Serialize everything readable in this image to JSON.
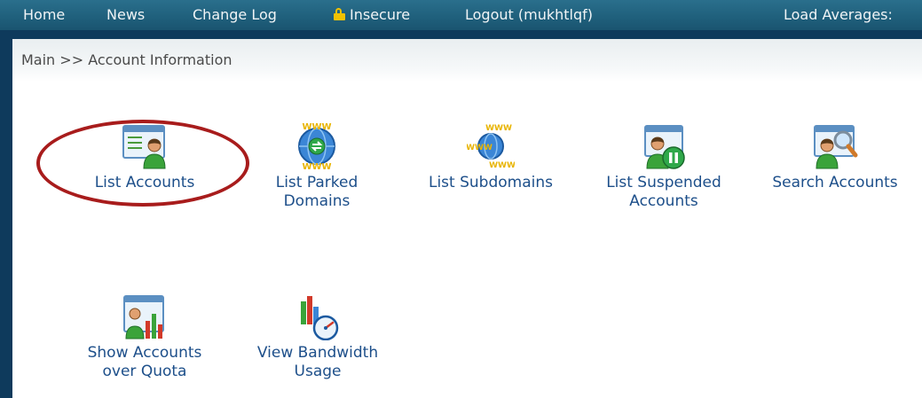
{
  "topnav": {
    "home": "Home",
    "news": "News",
    "change_log": "Change Log",
    "insecure": "Insecure",
    "logout": "Logout (mukhtlqf)",
    "load_averages": "Load Averages:"
  },
  "breadcrumb": {
    "main": "Main",
    "separator": ">>",
    "current": "Account Information"
  },
  "tiles": [
    {
      "label": "List Accounts",
      "icon": "list-accounts-icon"
    },
    {
      "label": "List Parked\nDomains",
      "icon": "www-parked-domains-icon"
    },
    {
      "label": "List Subdomains",
      "icon": "www-subdomains-icon"
    },
    {
      "label": "List Suspended\nAccounts",
      "icon": "suspended-accounts-icon"
    },
    {
      "label": "Search Accounts",
      "icon": "search-accounts-icon"
    },
    {
      "label": "Show Accounts\nover Quota",
      "icon": "accounts-over-quota-icon"
    },
    {
      "label": "View Bandwidth\nUsage",
      "icon": "bandwidth-usage-icon"
    }
  ],
  "colors": {
    "frame": "#0e3a5c",
    "topbar": "#1f5f7b",
    "link": "#1d4f8a",
    "highlight": "#a81c1c"
  }
}
